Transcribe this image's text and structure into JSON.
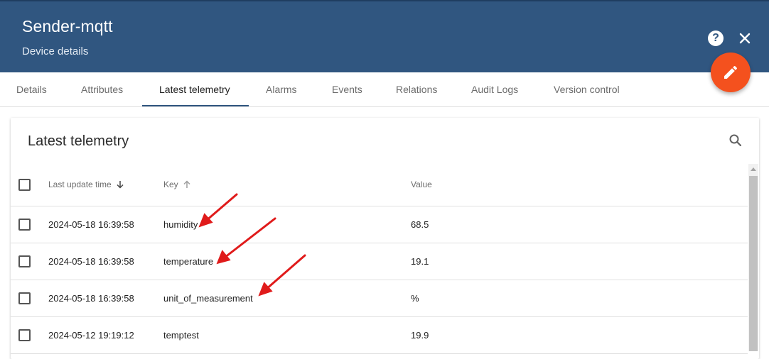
{
  "header": {
    "title": "Sender-mqtt",
    "subtitle": "Device details",
    "help_icon": "help-circle-icon",
    "close_icon": "close-icon",
    "edit_icon": "pencil-icon",
    "bg_color": "#305680",
    "fab_color": "#f4511e"
  },
  "tabs": [
    {
      "label": "Details"
    },
    {
      "label": "Attributes"
    },
    {
      "label": "Latest telemetry",
      "active": true
    },
    {
      "label": "Alarms"
    },
    {
      "label": "Events"
    },
    {
      "label": "Relations"
    },
    {
      "label": "Audit Logs"
    },
    {
      "label": "Version control"
    }
  ],
  "card": {
    "title": "Latest telemetry",
    "search_icon": "search-icon",
    "columns": {
      "time": "Last update time",
      "key": "Key",
      "value": "Value"
    },
    "rows": [
      {
        "time": "2024-05-18 16:39:58",
        "key": "humidity",
        "value": "68.5"
      },
      {
        "time": "2024-05-18 16:39:58",
        "key": "temperature",
        "value": "19.1"
      },
      {
        "time": "2024-05-18 16:39:58",
        "key": "unit_of_measurement",
        "value": "%"
      },
      {
        "time": "2024-05-12 19:19:12",
        "key": "temptest",
        "value": "19.9"
      }
    ]
  },
  "annotation_color": "#e01b1b"
}
